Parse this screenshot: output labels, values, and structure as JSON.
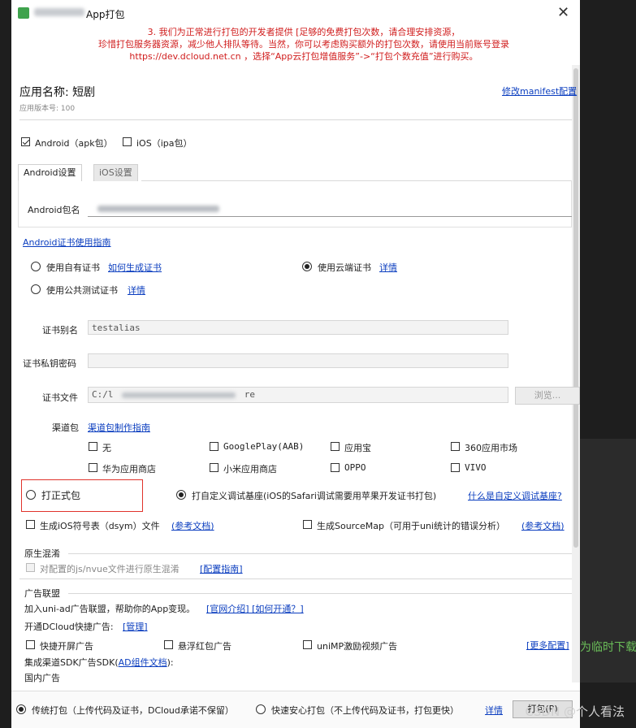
{
  "window": {
    "title": "App打包",
    "close_icon": "close-icon"
  },
  "notice": {
    "line1": "3. 我们为正常进行打包的开发者提供 [足够的免费打包次数，请合理安排资源，",
    "line2": "珍惜打包服务器资源，减少他人排队等待。当然，你可以考虑购买额外的打包次数，请使用当前账号登录",
    "line3": "https://dev.dcloud.net.cn ，选择“App云打包增值服务”->“打包个数充值”进行购买。"
  },
  "app": {
    "name_label": "应用名称: 短剧",
    "version_label": "应用版本号: 100",
    "modify_manifest_link": "修改manifest配置"
  },
  "platforms": {
    "android_label": "Android（apk包）",
    "ios_label": "iOS（ipa包）",
    "android_checked": true,
    "ios_checked": false
  },
  "tabs": {
    "android": "Android设置",
    "ios": "iOS设置"
  },
  "android": {
    "package_label": "Android包名",
    "cert_guide_link": "Android证书使用指南",
    "cert_options": {
      "own": "使用自有证书",
      "how_to": "如何生成证书",
      "cloud": "使用云端证书",
      "cloud_detail": "详情",
      "public": "使用公共测试证书",
      "public_detail": "详情"
    },
    "alias_label": "证书别名",
    "alias_value": "testalias",
    "password_label": "证书私钥密码",
    "file_label": "证书文件",
    "file_value_start": "C:/l",
    "file_value_end": "re",
    "browse_button": "浏览...",
    "channel_label": "渠道包",
    "channel_link": "渠道包制作指南",
    "channels": [
      "无",
      "GooglePlay(AAB)",
      "应用宝",
      "360应用市场",
      "华为应用商店",
      "小米应用商店",
      "OPPO",
      "VIVO"
    ]
  },
  "build_type": {
    "release": "打正式包",
    "custom_debug": "打自定义调试基座(iOS的Safari调试需要用苹果开发证书打包)",
    "what_is_link": "什么是自定义调试基座?"
  },
  "options": {
    "ios_dsym": "生成iOS符号表（dsym）文件",
    "ios_dsym_link": "(参考文档)",
    "sourcemap": "生成SourceMap（可用于uni统计的错误分析）",
    "sourcemap_link": "(参考文档)"
  },
  "obfuscation": {
    "title": "原生混淆",
    "checkbox": "对配置的js/nvue文件进行原生混淆",
    "guide_link": "[配置指南]"
  },
  "ads": {
    "title": "广告联盟",
    "intro": "加入uni-ad广告联盟，帮助你的App变现。",
    "intro_link": "[官网介绍] [如何开通？]",
    "dcloud_label": "开通DCloud快捷广告:",
    "manage_link": "[管理]",
    "splash": "快捷开屏广告",
    "float": "悬浮红包广告",
    "video": "uniMP激励视频广告",
    "more_link": "[更多配置]",
    "sdk_label": "集成渠道SDK广告SDK(",
    "sdk_link": "AD组件文档",
    "sdk_suffix": "):",
    "domestic": "国内广告"
  },
  "footer": {
    "traditional": "传统打包（上传代码及证书，DCloud承诺不保留）",
    "fast_safe": "快速安心打包（不上传代码及证书，打包更快）",
    "detail_link": "详情",
    "pack_button": "打包(P)"
  },
  "background": {
    "side_text": "为临时下载",
    "watermark": "CSDN @个人看法"
  }
}
